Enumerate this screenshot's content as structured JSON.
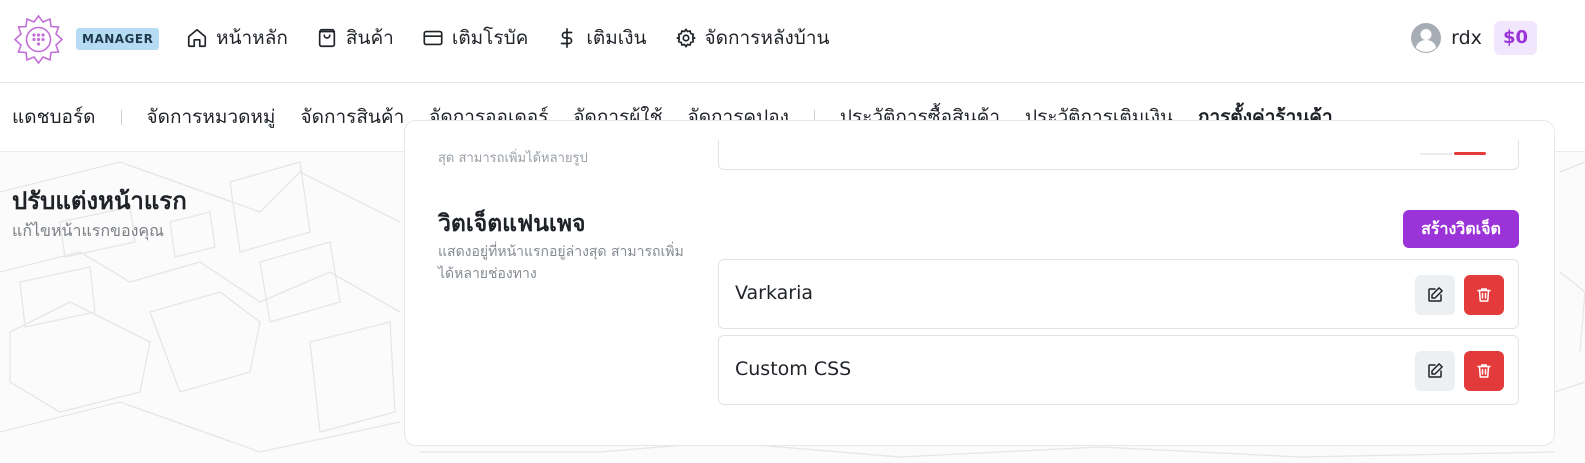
{
  "header": {
    "role_badge": "MANAGER",
    "nav": [
      {
        "label": "หน้าหลัก",
        "icon": "home-icon"
      },
      {
        "label": "สินค้า",
        "icon": "shopping-bag-icon"
      },
      {
        "label": "เติมโรบัค",
        "icon": "credit-card-icon"
      },
      {
        "label": "เติมเงิน",
        "icon": "dollar-icon"
      },
      {
        "label": "จัดการหลังบ้าน",
        "icon": "gear-icon"
      }
    ],
    "username": "rdx",
    "balance": "$0"
  },
  "subnav": {
    "items": [
      {
        "label": "แดชบอร์ด"
      },
      {
        "label": "จัดการหมวดหมู่"
      },
      {
        "label": "จัดการสินค้า"
      },
      {
        "label": "จัดการออเดอร์"
      },
      {
        "label": "จัดการผู้ใช้"
      },
      {
        "label": "จัดการคูปอง"
      },
      {
        "label": "ประวัติการซื้อสินค้า"
      },
      {
        "label": "ประวัติการเติมเงิน"
      },
      {
        "label": "การตั้งค่าร้านค้า"
      }
    ],
    "active": "การตั้งค่าร้านค้า"
  },
  "section": {
    "title": "ปรับแต่งหน้าแรก",
    "subtitle": "แก้ไขหน้าแรกของคุณ"
  },
  "card": {
    "previous_desc_tail": "สุด สามารถเพิ่มได้หลายรูป",
    "widget_title": "วิตเจ็ตแฟนเพจ",
    "widget_desc": "แสดงอยู่ที่หน้าแรกอยู่ล่างสุด สามารถเพิ่มได้หลายช่องทาง",
    "create_button": "สร้างวิตเจ็ต",
    "widgets": [
      {
        "name": "Varkaria"
      },
      {
        "name": "Custom CSS"
      }
    ]
  },
  "colors": {
    "accent": "#9b34d8",
    "danger": "#e33b3b",
    "badge_bg": "#b6dcf3"
  }
}
